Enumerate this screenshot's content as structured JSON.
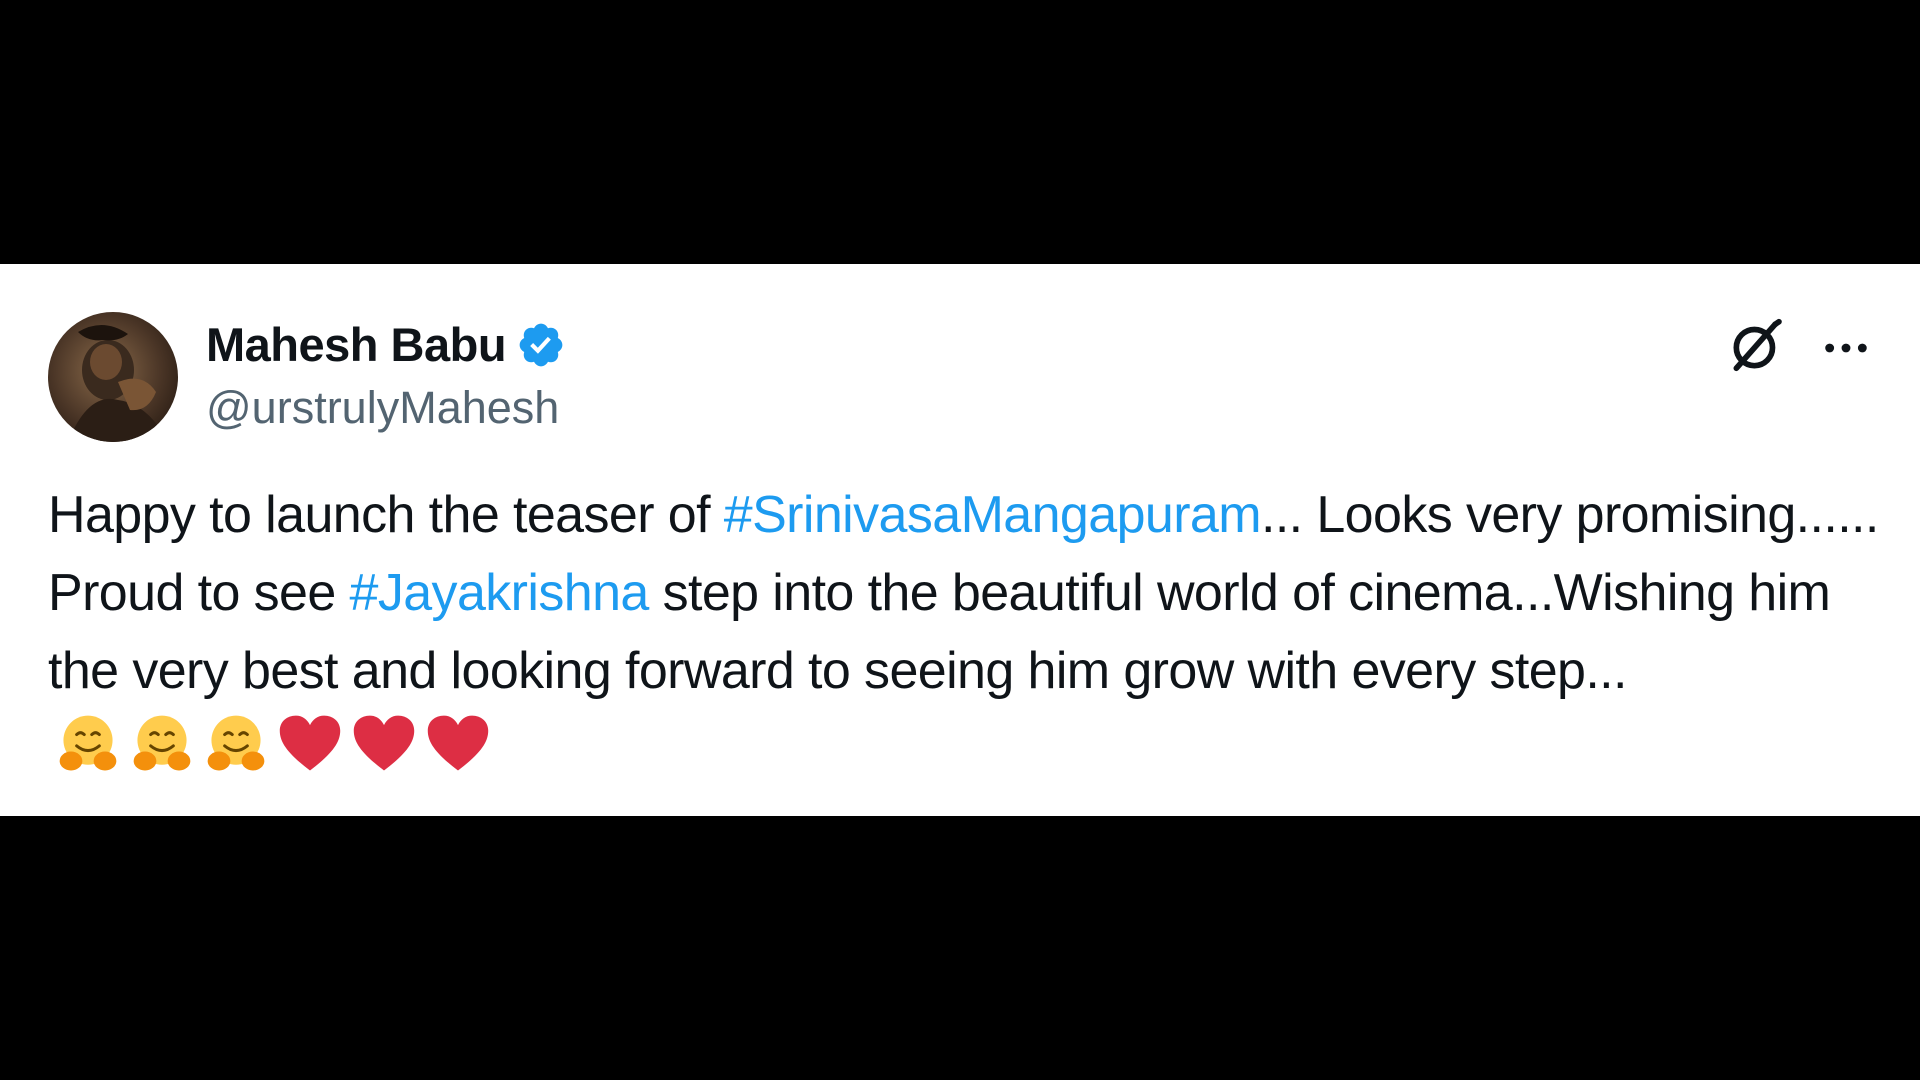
{
  "tweet": {
    "author": {
      "display_name": "Mahesh Babu",
      "handle": "@urstrulyMahesh",
      "verified": true
    },
    "icons": {
      "verified": "verified-badge-icon",
      "grok": "grok-icon",
      "more": "more-options-icon",
      "hug": "hugging-face-emoji",
      "heart": "red-heart-emoji"
    },
    "colors": {
      "hashtag": "#1d9bf0",
      "verified": "#1d9bf0",
      "text": "#0f1419",
      "handle": "#536471",
      "heart": "#e0245e"
    },
    "body": {
      "part1": "Happy to launch the teaser of ",
      "hashtag1": "#SrinivasaMangapuram",
      "part2": "... Looks very promising...... Proud to see ",
      "hashtag2": "#Jayakrishna",
      "part3": " step into the beautiful world of cinema...Wishing him the very best and looking forward to seeing him grow with every step...",
      "emojis": [
        "🤗",
        "🤗",
        "🤗",
        "❤️",
        "❤️",
        "❤️"
      ]
    }
  }
}
